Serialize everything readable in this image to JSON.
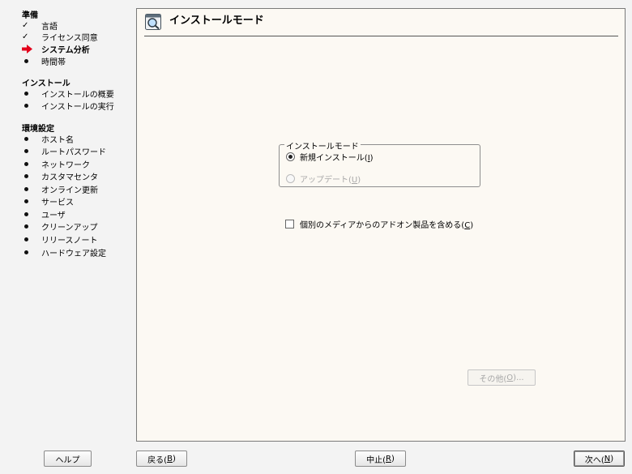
{
  "sidebar": {
    "sections": [
      {
        "title": "準備",
        "items": [
          {
            "label": "言語",
            "state": "done"
          },
          {
            "label": "ライセンス同意",
            "state": "done"
          },
          {
            "label": "システム分析",
            "state": "current"
          },
          {
            "label": "時間帯",
            "state": "pending"
          }
        ]
      },
      {
        "title": "インストール",
        "items": [
          {
            "label": "インストールの概要",
            "state": "pending"
          },
          {
            "label": "インストールの実行",
            "state": "pending"
          }
        ]
      },
      {
        "title": "環境設定",
        "items": [
          {
            "label": "ホスト名",
            "state": "pending"
          },
          {
            "label": "ルートパスワード",
            "state": "pending"
          },
          {
            "label": "ネットワーク",
            "state": "pending"
          },
          {
            "label": "カスタマセンタ",
            "state": "pending"
          },
          {
            "label": "オンライン更新",
            "state": "pending"
          },
          {
            "label": "サービス",
            "state": "pending"
          },
          {
            "label": "ユーザ",
            "state": "pending"
          },
          {
            "label": "クリーンアップ",
            "state": "pending"
          },
          {
            "label": "リリースノート",
            "state": "pending"
          },
          {
            "label": "ハードウェア設定",
            "state": "pending"
          }
        ]
      }
    ]
  },
  "header": {
    "title": "インストールモード",
    "icon": "magnifier-window-icon"
  },
  "mode_group": {
    "legend": "インストールモード",
    "options": [
      {
        "text": "新規インストール(",
        "key": "I",
        "close": ")",
        "selected": true,
        "disabled": false
      },
      {
        "text": "アップデート(",
        "key": "U",
        "close": ")",
        "selected": false,
        "disabled": true
      }
    ]
  },
  "addon_checkbox": {
    "text": "個別のメディアからのアドオン製品を含める(",
    "key": "C",
    "close": ")",
    "checked": false
  },
  "buttons": {
    "other": {
      "text": "その他(",
      "key": "O",
      "close": ")..."
    },
    "help": {
      "text": "ヘルプ"
    },
    "back": {
      "text": "戻る(",
      "key": "B",
      "close": ")"
    },
    "abort": {
      "text": "中止(",
      "key": "R",
      "close": ")"
    },
    "next": {
      "text": "次へ(",
      "key": "N",
      "close": ")"
    }
  },
  "colors": {
    "arrow": "#e3001b",
    "panel_bg": "#fcf9f3",
    "window_bg": "#f3f3f3"
  }
}
